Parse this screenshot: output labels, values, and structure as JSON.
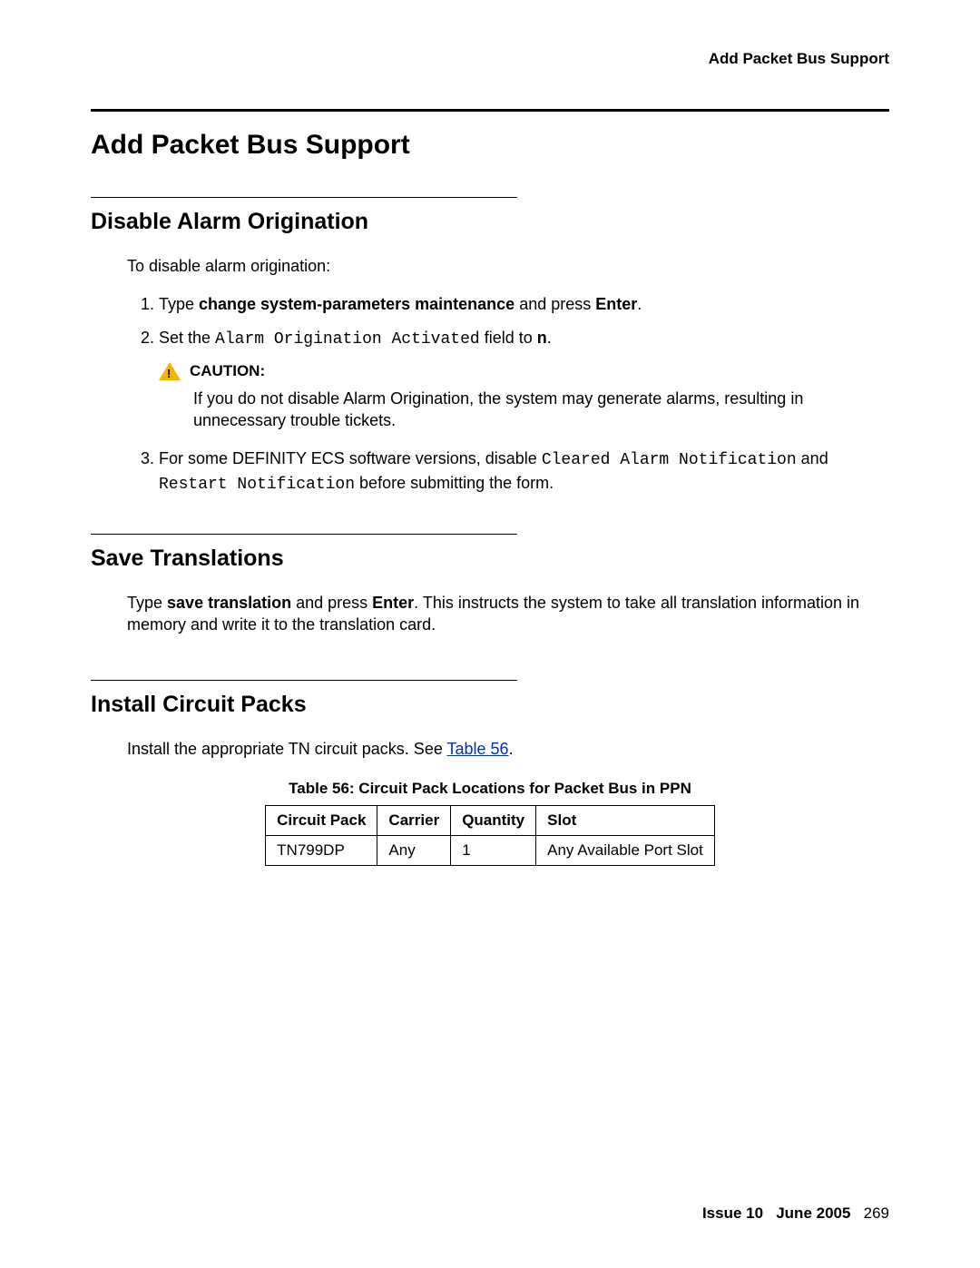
{
  "running_head": "Add Packet Bus Support",
  "page_title": "Add Packet Bus Support",
  "sections": {
    "disable": {
      "heading": "Disable Alarm Origination",
      "intro": "To disable alarm origination:",
      "step1_a": "Type ",
      "step1_b": "change system-parameters maintenance",
      "step1_c": " and press ",
      "step1_d": "Enter",
      "step1_e": ".",
      "step2_a": "Set the ",
      "step2_b": "Alarm Origination Activated",
      "step2_c": " field to ",
      "step2_d": "n",
      "step2_e": ".",
      "caution_label": "CAUTION:",
      "caution_text": "If you do not disable Alarm Origination, the system may generate alarms, resulting in unnecessary trouble tickets.",
      "step3_a": "For some DEFINITY ECS software versions, disable ",
      "step3_b": "Cleared Alarm Notification",
      "step3_c": " and ",
      "step3_d": "Restart Notification",
      "step3_e": " before submitting the form."
    },
    "save": {
      "heading": "Save Translations",
      "para_a": "Type ",
      "para_b": "save translation",
      "para_c": " and press ",
      "para_d": "Enter",
      "para_e": ". This instructs the system to take all translation information in memory and write it to the translation card."
    },
    "install": {
      "heading": "Install Circuit Packs",
      "para_a": "Install the appropriate TN circuit packs. See ",
      "para_link": "Table 56",
      "para_b": ".",
      "table_caption": "Table 56: Circuit Pack Locations for Packet Bus in PPN",
      "headers": {
        "c1": "Circuit Pack",
        "c2": "Carrier",
        "c3": "Quantity",
        "c4": "Slot"
      },
      "row1": {
        "c1": "TN799DP",
        "c2": "Any",
        "c3": "1",
        "c4": "Any Available Port Slot"
      }
    }
  },
  "footer": {
    "issue": "Issue 10",
    "date": "June 2005",
    "page": "269"
  }
}
